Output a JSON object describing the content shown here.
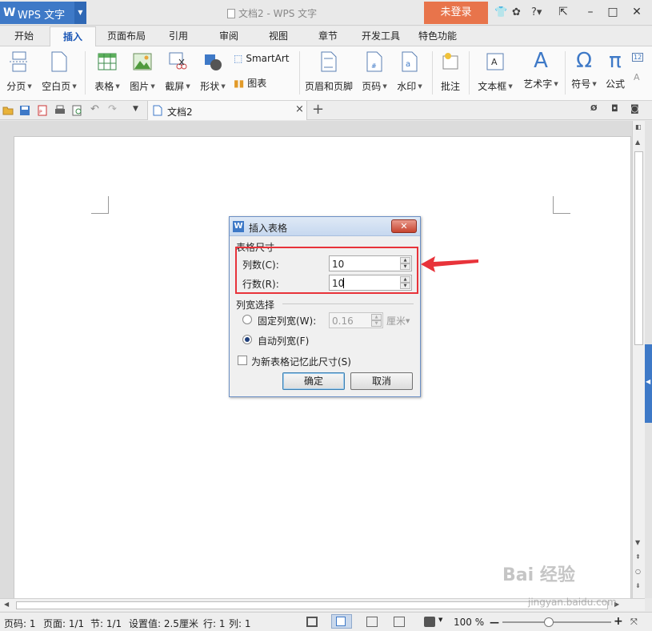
{
  "app": {
    "name": "WPS 文字",
    "window_title": "文档2 - WPS 文字",
    "login": "未登录"
  },
  "tabs": [
    "开始",
    "插入",
    "页面布局",
    "引用",
    "审阅",
    "视图",
    "章节",
    "开发工具",
    "特色功能"
  ],
  "active_tab": "插入",
  "ribbon": {
    "page_break": "分页",
    "blank_page": "空白页",
    "table": "表格",
    "picture": "图片",
    "screenshot": "截屏",
    "shape": "形状",
    "smartart": "SmartArt",
    "chart": "图表",
    "header_footer": "页眉和页脚",
    "page_number": "页码",
    "watermark": "水印",
    "comment": "批注",
    "textbox": "文本框",
    "wordart": "艺术字",
    "symbol": "符号",
    "formula": "公式"
  },
  "doc_tab": {
    "label": "文档2"
  },
  "dialog": {
    "title": "插入表格",
    "group_size": "表格尺寸",
    "columns_label": "列数(C):",
    "columns_value": "10",
    "rows_label": "行数(R):",
    "rows_value": "10",
    "group_width": "列宽选择",
    "fixed_width_label": "固定列宽(W):",
    "fixed_width_value": "0.16",
    "fixed_width_unit": "厘米",
    "auto_width_label": "自动列宽(F)",
    "remember_label": "为新表格记忆此尺寸(S)",
    "ok": "确定",
    "cancel": "取消"
  },
  "status": {
    "page_num": "页码: 1",
    "pages": "页面: 1/1",
    "section": "节: 1/1",
    "setting": "设置值: 2.5厘米",
    "row": "行: 1",
    "col": "列: 1",
    "zoom": "100 %",
    "zoom_fraction": 0.43
  },
  "watermark": {
    "logo": "Bai 经验",
    "url": "jingyan.baidu.com"
  },
  "colors": {
    "accent": "#3e79c7",
    "login": "#e8744b",
    "highlight": "#e8333a"
  }
}
